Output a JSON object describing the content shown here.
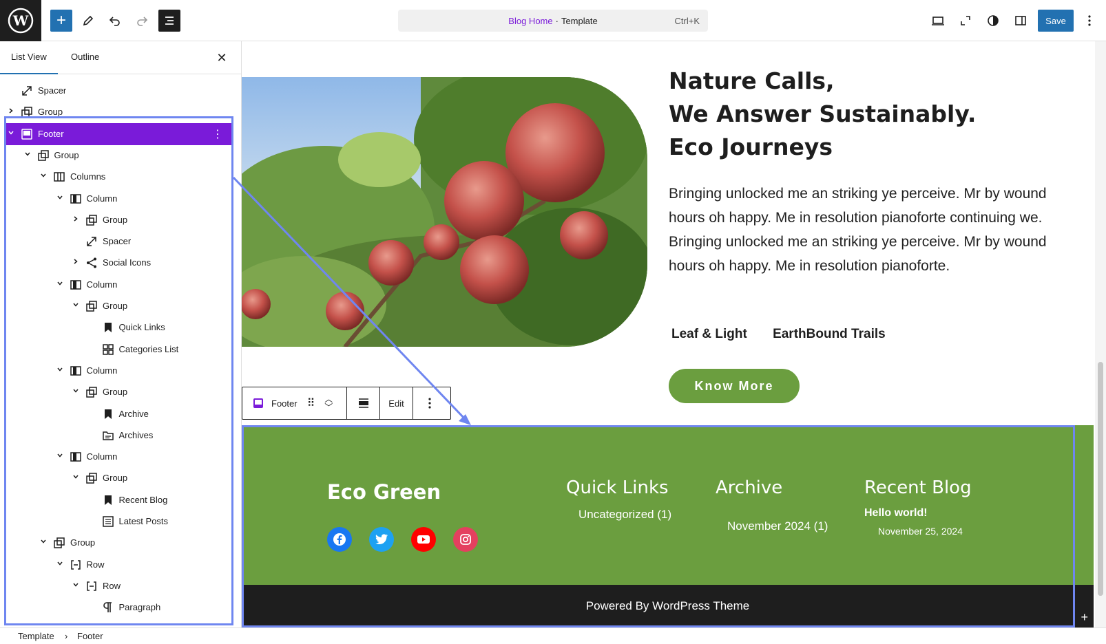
{
  "topbar": {
    "save_label": "Save",
    "command": {
      "template_name": "Blog Home",
      "separator": "·",
      "template_type": "Template",
      "shortcut": "Ctrl+K"
    }
  },
  "panel": {
    "tabs": [
      "List View",
      "Outline"
    ],
    "tree": [
      {
        "label": "Spacer",
        "icon": "spacer-icon",
        "depth": 0,
        "chevron": "none"
      },
      {
        "label": "Group",
        "icon": "group-icon",
        "depth": 0,
        "chevron": "right"
      },
      {
        "label": "Footer",
        "icon": "footer-icon",
        "depth": 0,
        "chevron": "down",
        "selected": true
      },
      {
        "label": "Group",
        "icon": "group-icon",
        "depth": 1,
        "chevron": "down"
      },
      {
        "label": "Columns",
        "icon": "columns-icon",
        "depth": 2,
        "chevron": "down"
      },
      {
        "label": "Column",
        "icon": "column-icon",
        "depth": 3,
        "chevron": "down"
      },
      {
        "label": "Group",
        "icon": "group-icon",
        "depth": 4,
        "chevron": "right"
      },
      {
        "label": "Spacer",
        "icon": "spacer-icon",
        "depth": 4,
        "chevron": "none"
      },
      {
        "label": "Social Icons",
        "icon": "share-icon",
        "depth": 4,
        "chevron": "right"
      },
      {
        "label": "Column",
        "icon": "column-icon",
        "depth": 3,
        "chevron": "down"
      },
      {
        "label": "Group",
        "icon": "group-icon",
        "depth": 4,
        "chevron": "down"
      },
      {
        "label": "Quick Links",
        "icon": "bookmark-icon",
        "depth": 5,
        "chevron": "none"
      },
      {
        "label": "Categories List",
        "icon": "categories-icon",
        "depth": 5,
        "chevron": "none"
      },
      {
        "label": "Column",
        "icon": "column-icon",
        "depth": 3,
        "chevron": "down"
      },
      {
        "label": "Group",
        "icon": "group-icon",
        "depth": 4,
        "chevron": "down"
      },
      {
        "label": "Archive",
        "icon": "bookmark-icon",
        "depth": 5,
        "chevron": "none"
      },
      {
        "label": "Archives",
        "icon": "archive-icon",
        "depth": 5,
        "chevron": "none"
      },
      {
        "label": "Column",
        "icon": "column-icon",
        "depth": 3,
        "chevron": "down"
      },
      {
        "label": "Group",
        "icon": "group-icon",
        "depth": 4,
        "chevron": "down"
      },
      {
        "label": "Recent Blog",
        "icon": "bookmark-icon",
        "depth": 5,
        "chevron": "none"
      },
      {
        "label": "Latest Posts",
        "icon": "list-icon",
        "depth": 5,
        "chevron": "none"
      },
      {
        "label": "Group",
        "icon": "group-icon",
        "depth": 2,
        "chevron": "down"
      },
      {
        "label": "Row",
        "icon": "row-icon",
        "depth": 3,
        "chevron": "down"
      },
      {
        "label": "Row",
        "icon": "row-icon",
        "depth": 4,
        "chevron": "down"
      },
      {
        "label": "Paragraph",
        "icon": "paragraph-icon",
        "depth": 5,
        "chevron": "none"
      }
    ]
  },
  "breadcrumb": [
    "Template",
    "Footer"
  ],
  "hero": {
    "heading": [
      "Nature Calls,",
      "We Answer Sustainably.",
      "Eco Journeys"
    ],
    "body": "Bringing unlocked me an striking ye perceive. Mr by wound hours oh happy. Me in resolution pianoforte continuing we. Bringing unlocked me an striking ye perceive. Mr by wound hours oh happy. Me in resolution pianoforte.",
    "links": [
      "Leaf & Light",
      "EarthBound Trails"
    ],
    "button": "Know More"
  },
  "block_toolbar": {
    "block_name": "Footer",
    "edit_label": "Edit"
  },
  "footer": {
    "brand": "Eco Green",
    "social": [
      "facebook-icon",
      "twitter-icon",
      "youtube-icon",
      "instagram-icon"
    ],
    "quick_links_title": "Quick Links",
    "quick_links_item": "Uncategorized (1)",
    "archive_title": "Archive",
    "archive_item": "November 2024 (1)",
    "recent_title": "Recent Blog",
    "recent_post": "Hello world!",
    "recent_date": "November 25, 2024",
    "powered": "Powered By WordPress Theme"
  },
  "colors": {
    "accent": "#2271b1",
    "selection": "#7a1bd9",
    "footer_green": "#6b9e3f",
    "outline": "#6f86f0"
  }
}
